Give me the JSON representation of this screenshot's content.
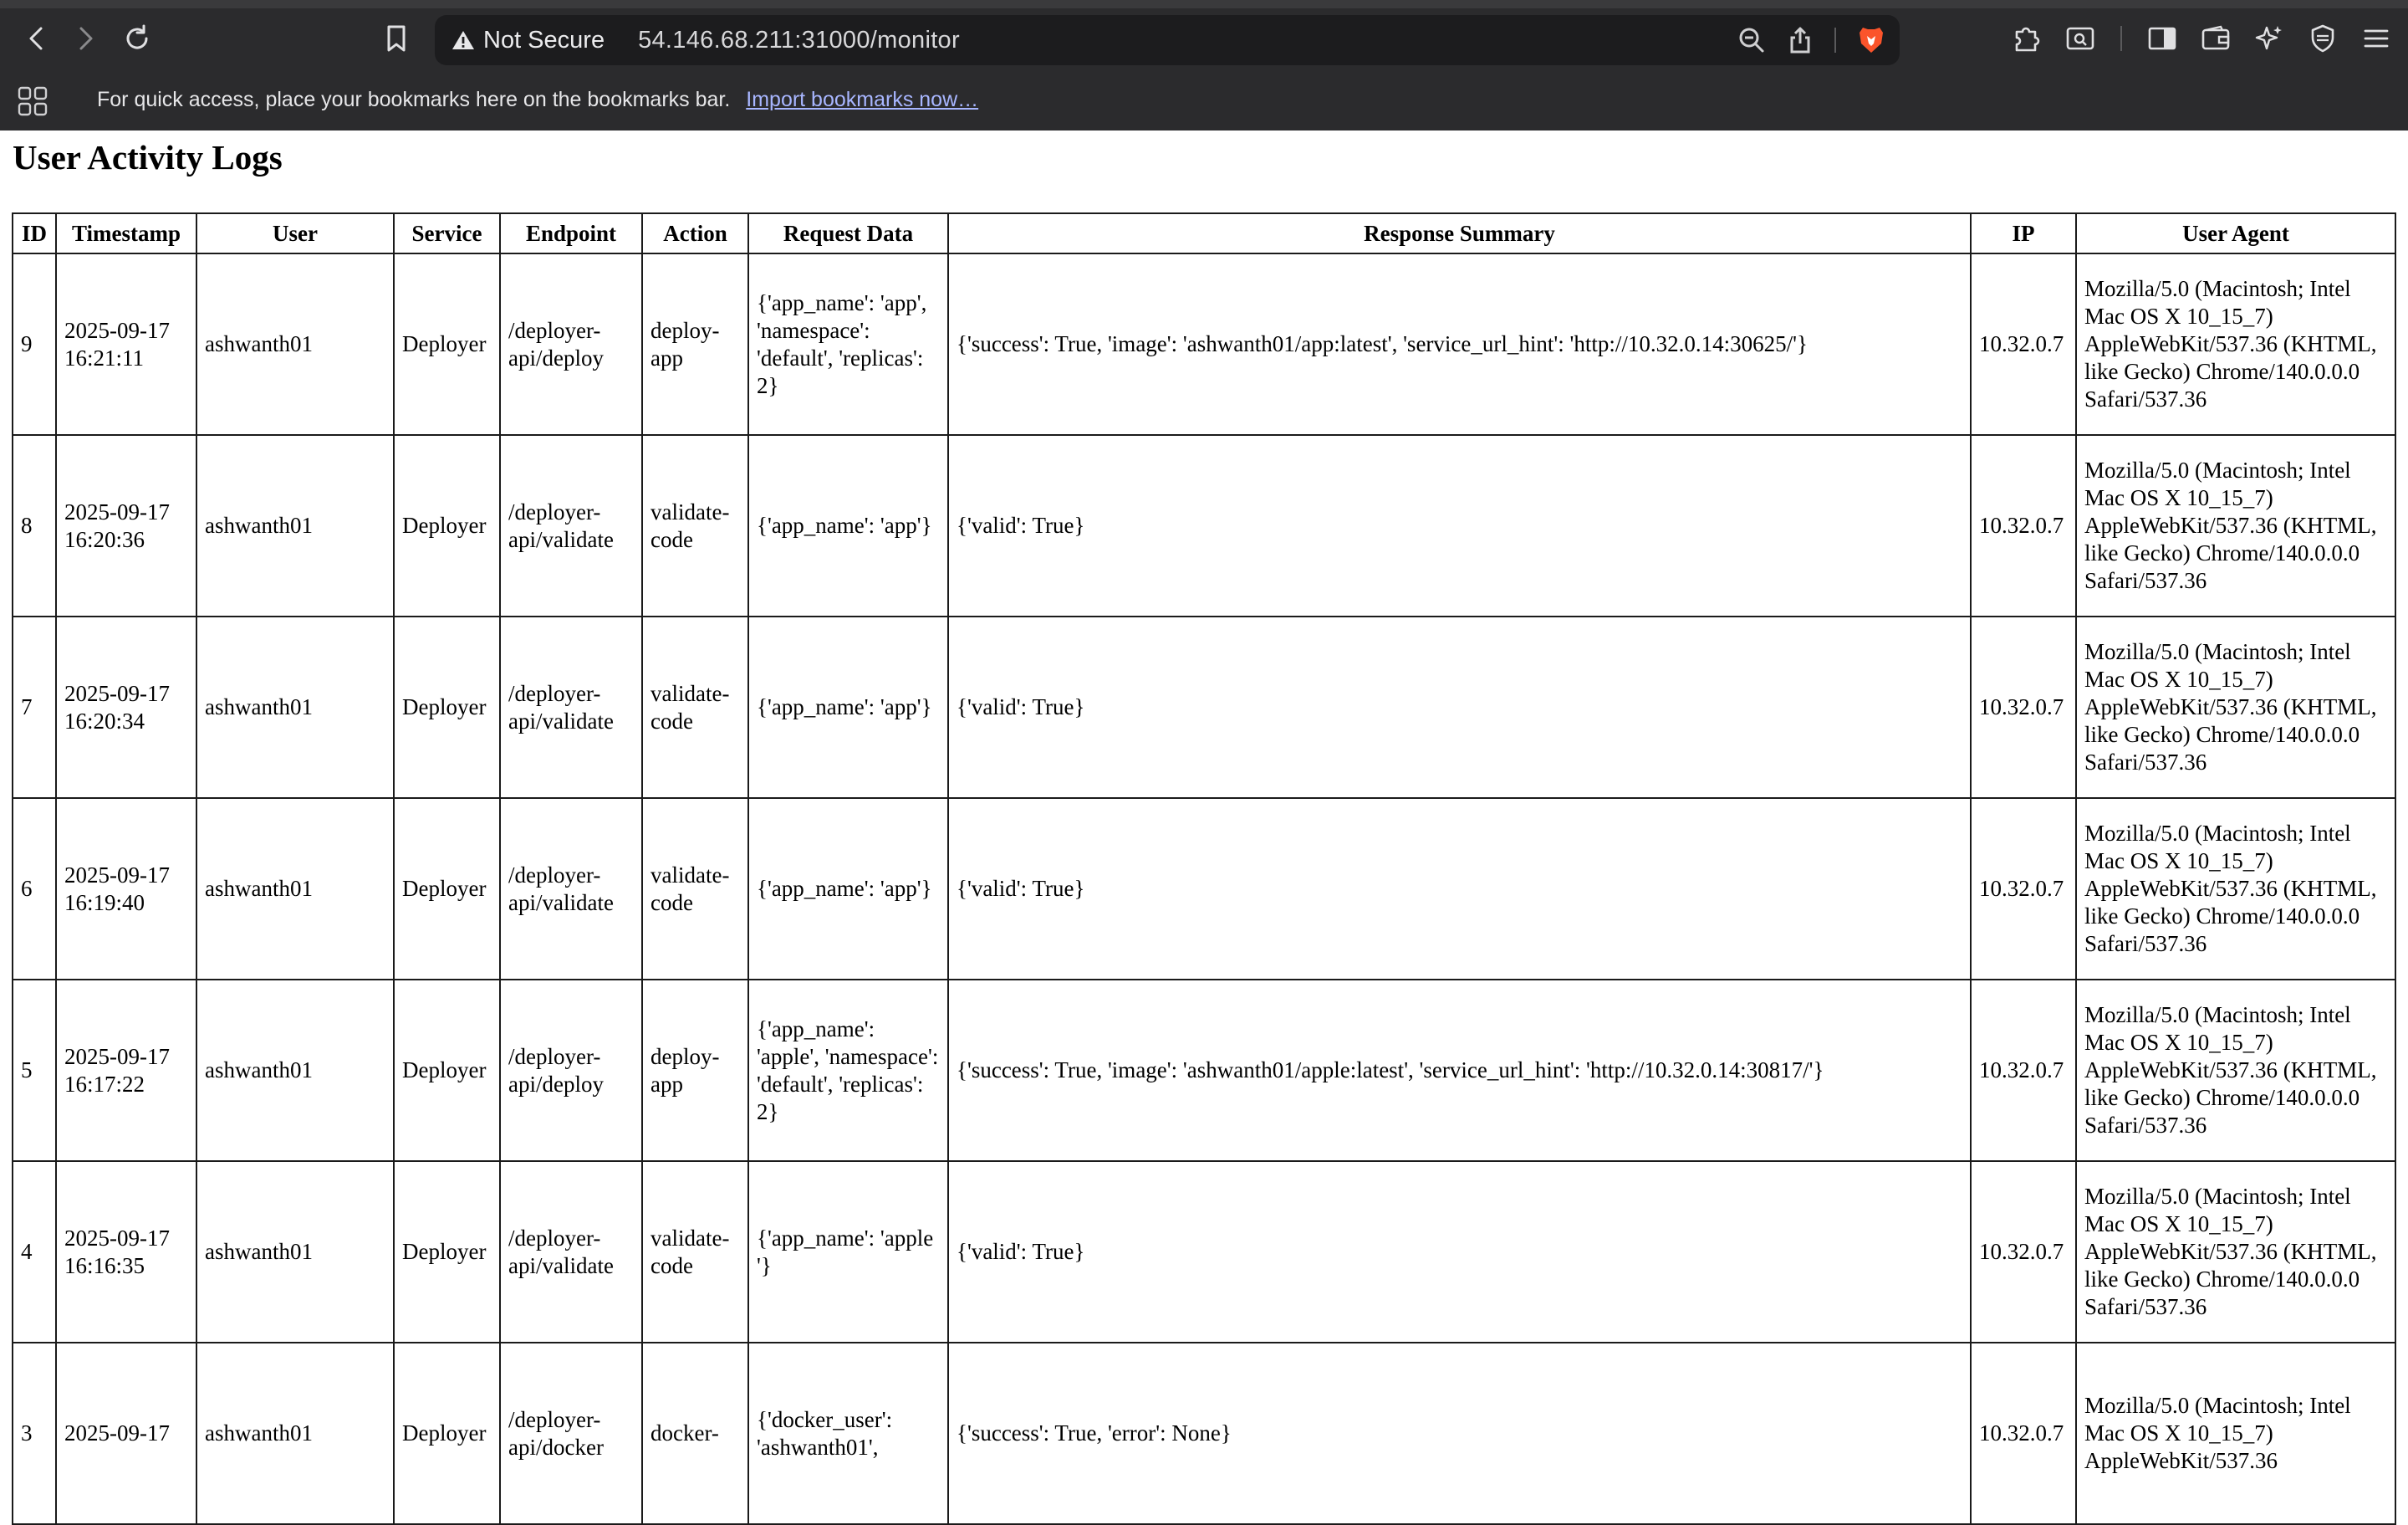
{
  "browser": {
    "security_label": "Not Secure",
    "url": "54.146.68.211:31000/monitor",
    "bookmarks_message": "For quick access, place your bookmarks here on the bookmarks bar.",
    "import_link": "Import bookmarks now…"
  },
  "page": {
    "title": "User Activity Logs",
    "columns": [
      "ID",
      "Timestamp",
      "User",
      "Service",
      "Endpoint",
      "Action",
      "Request Data",
      "Response Summary",
      "IP",
      "User Agent"
    ],
    "rows": [
      {
        "id": "9",
        "timestamp": "2025-09-17 16:21:11",
        "user": "ashwanth01",
        "service": "Deployer",
        "endpoint": "/deployer-api/deploy",
        "action": "deploy-app",
        "request": "{'app_name': 'app', 'namespace': 'default', 'replicas': 2}",
        "response": "{'success': True, 'image': 'ashwanth01/app:latest', 'service_url_hint': 'http://10.32.0.14:30625/'}",
        "ip": "10.32.0.7",
        "user_agent": "Mozilla/5.0 (Macintosh; Intel Mac OS X 10_15_7) AppleWebKit/537.36 (KHTML, like Gecko) Chrome/140.0.0.0 Safari/537.36"
      },
      {
        "id": "8",
        "timestamp": "2025-09-17 16:20:36",
        "user": "ashwanth01",
        "service": "Deployer",
        "endpoint": "/deployer-api/validate",
        "action": "validate-code",
        "request": "{'app_name': 'app'}",
        "response": "{'valid': True}",
        "ip": "10.32.0.7",
        "user_agent": "Mozilla/5.0 (Macintosh; Intel Mac OS X 10_15_7) AppleWebKit/537.36 (KHTML, like Gecko) Chrome/140.0.0.0 Safari/537.36"
      },
      {
        "id": "7",
        "timestamp": "2025-09-17 16:20:34",
        "user": "ashwanth01",
        "service": "Deployer",
        "endpoint": "/deployer-api/validate",
        "action": "validate-code",
        "request": "{'app_name': 'app'}",
        "response": "{'valid': True}",
        "ip": "10.32.0.7",
        "user_agent": "Mozilla/5.0 (Macintosh; Intel Mac OS X 10_15_7) AppleWebKit/537.36 (KHTML, like Gecko) Chrome/140.0.0.0 Safari/537.36"
      },
      {
        "id": "6",
        "timestamp": "2025-09-17 16:19:40",
        "user": "ashwanth01",
        "service": "Deployer",
        "endpoint": "/deployer-api/validate",
        "action": "validate-code",
        "request": "{'app_name': 'app'}",
        "response": "{'valid': True}",
        "ip": "10.32.0.7",
        "user_agent": "Mozilla/5.0 (Macintosh; Intel Mac OS X 10_15_7) AppleWebKit/537.36 (KHTML, like Gecko) Chrome/140.0.0.0 Safari/537.36"
      },
      {
        "id": "5",
        "timestamp": "2025-09-17 16:17:22",
        "user": "ashwanth01",
        "service": "Deployer",
        "endpoint": "/deployer-api/deploy",
        "action": "deploy-app",
        "request": "{'app_name': 'apple', 'namespace': 'default', 'replicas': 2}",
        "response": "{'success': True, 'image': 'ashwanth01/apple:latest', 'service_url_hint': 'http://10.32.0.14:30817/'}",
        "ip": "10.32.0.7",
        "user_agent": "Mozilla/5.0 (Macintosh; Intel Mac OS X 10_15_7) AppleWebKit/537.36 (KHTML, like Gecko) Chrome/140.0.0.0 Safari/537.36"
      },
      {
        "id": "4",
        "timestamp": "2025-09-17 16:16:35",
        "user": "ashwanth01",
        "service": "Deployer",
        "endpoint": "/deployer-api/validate",
        "action": "validate-code",
        "request": "{'app_name': 'apple '}",
        "response": "{'valid': True}",
        "ip": "10.32.0.7",
        "user_agent": "Mozilla/5.0 (Macintosh; Intel Mac OS X 10_15_7) AppleWebKit/537.36 (KHTML, like Gecko) Chrome/140.0.0.0 Safari/537.36"
      },
      {
        "id": "3",
        "timestamp": "2025-09-17",
        "user": "ashwanth01",
        "service": "Deployer",
        "endpoint": "/deployer-api/docker",
        "action": "docker-",
        "request": "{'docker_user': 'ashwanth01',",
        "response": "{'success': True, 'error': None}",
        "ip": "10.32.0.7",
        "user_agent": "Mozilla/5.0 (Macintosh; Intel Mac OS X 10_15_7) AppleWebKit/537.36"
      }
    ]
  }
}
